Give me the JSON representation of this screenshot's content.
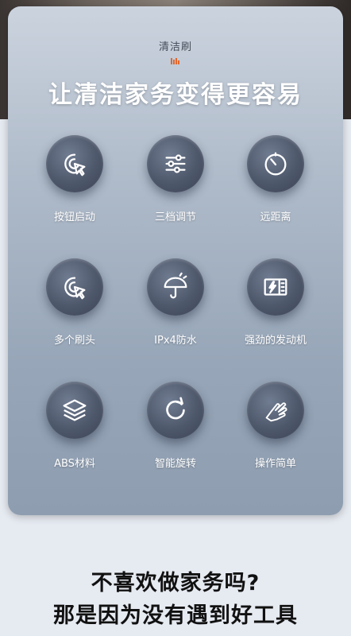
{
  "header": {
    "brand": "清洁刷",
    "headline": "让清洁家务变得更容易"
  },
  "colors": {
    "brand_mark": "#e0672e",
    "icon_stroke": "#ffffff"
  },
  "features": [
    {
      "label": "按钮启动",
      "icon": "pointer-click-icon"
    },
    {
      "label": "三档调节",
      "icon": "sliders-icon"
    },
    {
      "label": "远距离",
      "icon": "timer-gauge-icon"
    },
    {
      "label": "多个刷头",
      "icon": "pointer-click-icon"
    },
    {
      "label": "IPx4防水",
      "icon": "umbrella-rain-icon"
    },
    {
      "label": "强劲的发动机",
      "icon": "battery-bolt-icon"
    },
    {
      "label": "ABS材料",
      "icon": "layers-icon"
    },
    {
      "label": "智能旋转",
      "icon": "rotate-icon"
    },
    {
      "label": "操作简单",
      "icon": "hand-icon"
    }
  ],
  "footer": {
    "line1": "不喜欢做家务吗?",
    "line2": "那是因为没有遇到好工具"
  }
}
